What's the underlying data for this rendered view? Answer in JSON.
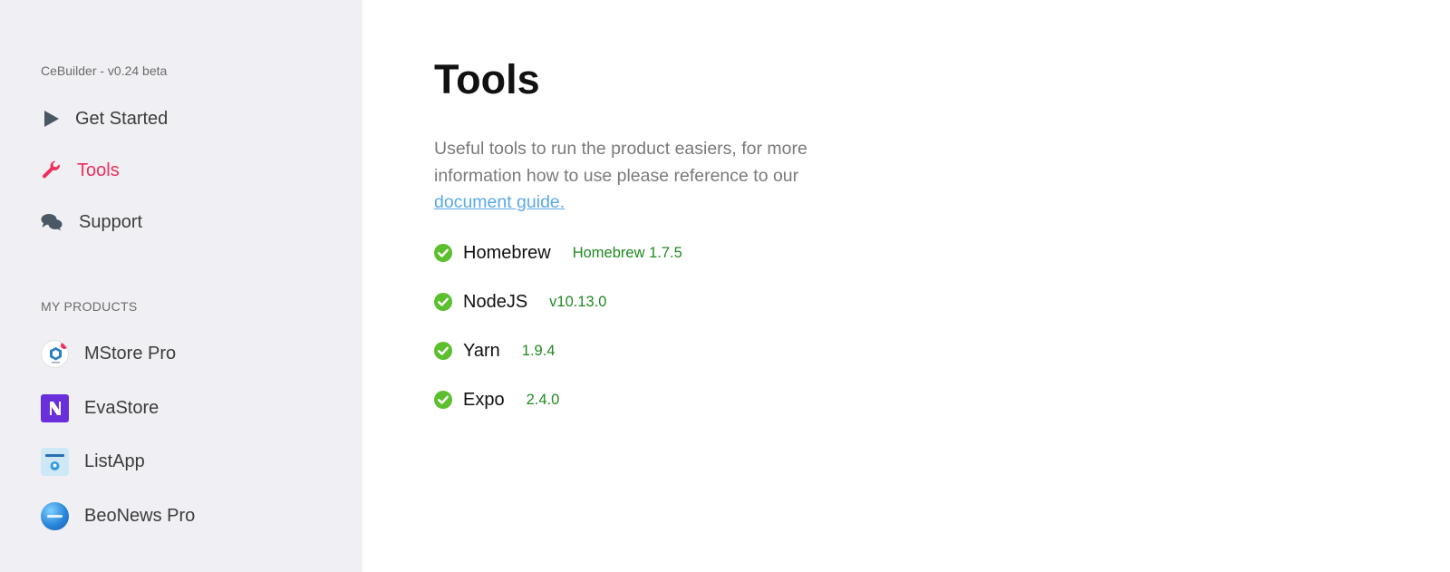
{
  "sidebar": {
    "version": "CeBuilder - v0.24 beta",
    "nav": [
      {
        "label": "Get Started",
        "icon": "play-icon"
      },
      {
        "label": "Tools",
        "icon": "wrench-icon",
        "active": true
      },
      {
        "label": "Support",
        "icon": "chat-bubbles-icon"
      }
    ],
    "products_title": "MY PRODUCTS",
    "products": [
      {
        "label": "MStore Pro",
        "icon": "mstore-logo-icon"
      },
      {
        "label": "EvaStore",
        "icon": "evastore-logo-icon"
      },
      {
        "label": "ListApp",
        "icon": "listapp-logo-icon"
      },
      {
        "label": "BeoNews Pro",
        "icon": "beonews-logo-icon"
      }
    ]
  },
  "main": {
    "title": "Tools",
    "description": "Useful tools to run the product easiers, for more information how to use please reference to our",
    "link_text": "document guide.",
    "tools": [
      {
        "name": "Homebrew",
        "version": "Homebrew 1.7.5",
        "status": "installed"
      },
      {
        "name": "NodeJS",
        "version": "v10.13.0",
        "status": "installed"
      },
      {
        "name": "Yarn",
        "version": "1.9.4",
        "status": "installed"
      },
      {
        "name": "Expo",
        "version": "2.4.0",
        "status": "installed"
      }
    ]
  },
  "colors": {
    "sidebar_bg": "#f0eff3",
    "active": "#ee2f5c",
    "link": "#5aa9e6",
    "version_green": "#1f8a1f",
    "check_green": "#5bbf2e"
  }
}
